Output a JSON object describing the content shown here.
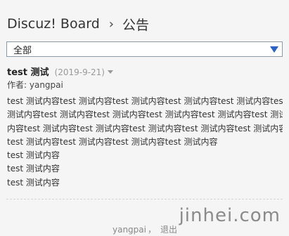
{
  "breadcrumb": {
    "site": "Discuz! Board",
    "separator": "›",
    "current": "公告"
  },
  "filter": {
    "selected": "全部",
    "arrow_icon": "triangle-down-icon",
    "arrow_color": "#2a62c8"
  },
  "post": {
    "title": "test 测试",
    "date": "(2019-9-21)",
    "author_label": "作者: yangpai",
    "body_lines": [
      "test 测试内容test 测试内容test 测试内容test 测试内容test 测试内容test",
      "测试内容test 测试内容test 测试内容test 测试内容test 测试内容test 测试",
      "内容test 测试内容test 测试内容test 测试内容test 测试内容test 测试内容",
      "test 测试内容test 测试内容test 测试内容test 测试内容",
      "test 测试内容",
      "test 测试内容",
      "test 测试内容"
    ]
  },
  "footer": {
    "user": "yangpai",
    "comma": "，",
    "logout": "退出"
  },
  "watermark": "jinhei.com"
}
